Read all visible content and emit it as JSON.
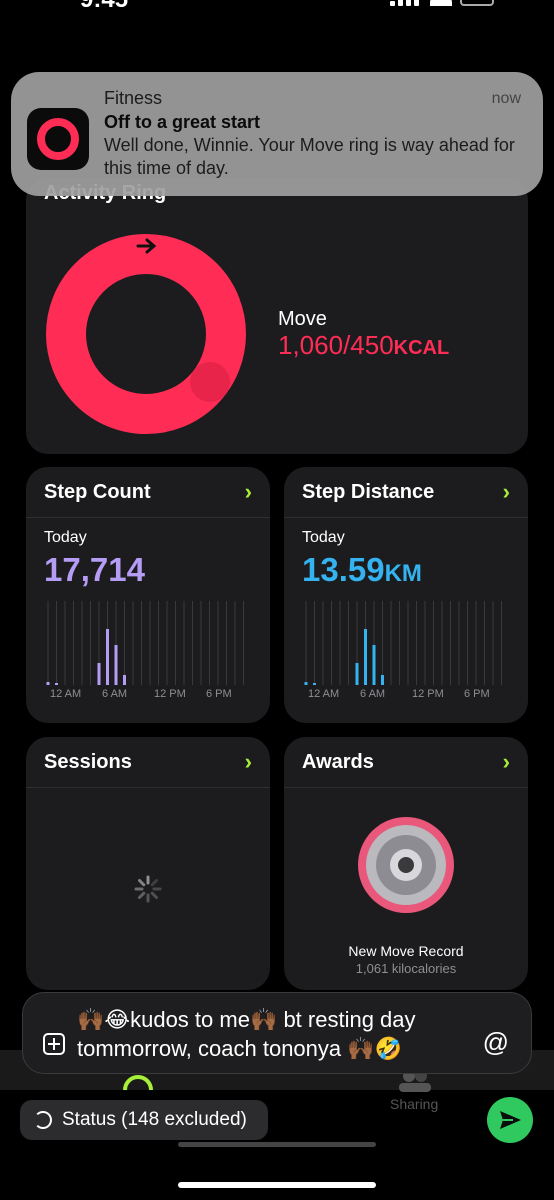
{
  "status_bar": {
    "time": "9:45"
  },
  "notification": {
    "app": "Fitness",
    "time": "now",
    "title": "Off to a great start",
    "body": "Well done, Winnie. Your Move ring is way ahead for this time of day."
  },
  "activity": {
    "heading": "Activity Ring",
    "move_label": "Move",
    "move_value": "1,060/450",
    "move_unit": "KCAL",
    "ring_color": "#ff2d55",
    "ring_progress": 2.36
  },
  "step_count": {
    "title": "Step Count",
    "today_label": "Today",
    "value": "17,714",
    "color": "#b59cf5",
    "axis_labels": [
      "12 AM",
      "6 AM",
      "12 PM",
      "6 PM"
    ]
  },
  "step_distance": {
    "title": "Step Distance",
    "today_label": "Today",
    "value": "13.59",
    "unit": "KM",
    "color": "#34b3f0",
    "axis_labels": [
      "12 AM",
      "6 AM",
      "12 PM",
      "6 PM"
    ]
  },
  "sessions": {
    "title": "Sessions"
  },
  "awards": {
    "title": "Awards",
    "award_name": "New Move Record",
    "award_detail": "1,061 kilocalories"
  },
  "tabbar": {
    "sharing_label": "Sharing"
  },
  "composer": {
    "text": "🙌🏾😂kudos to me🙌🏾 bt resting day tommorrow, coach tononya 🙌🏾🤣",
    "at_symbol": "@"
  },
  "status_chip": {
    "label": "Status (148 excluded)"
  },
  "colors": {
    "accent_green": "#a7f03a",
    "send_green": "#2fc960"
  },
  "icons": {
    "chevron": "chevron-right-icon",
    "send": "send-icon",
    "attach": "add-attachment-icon",
    "at": "at-symbol-icon",
    "status": "status-icon",
    "spinner": "loading-spinner-icon",
    "medal": "award-medal-icon",
    "app": "fitness-app-icon"
  }
}
